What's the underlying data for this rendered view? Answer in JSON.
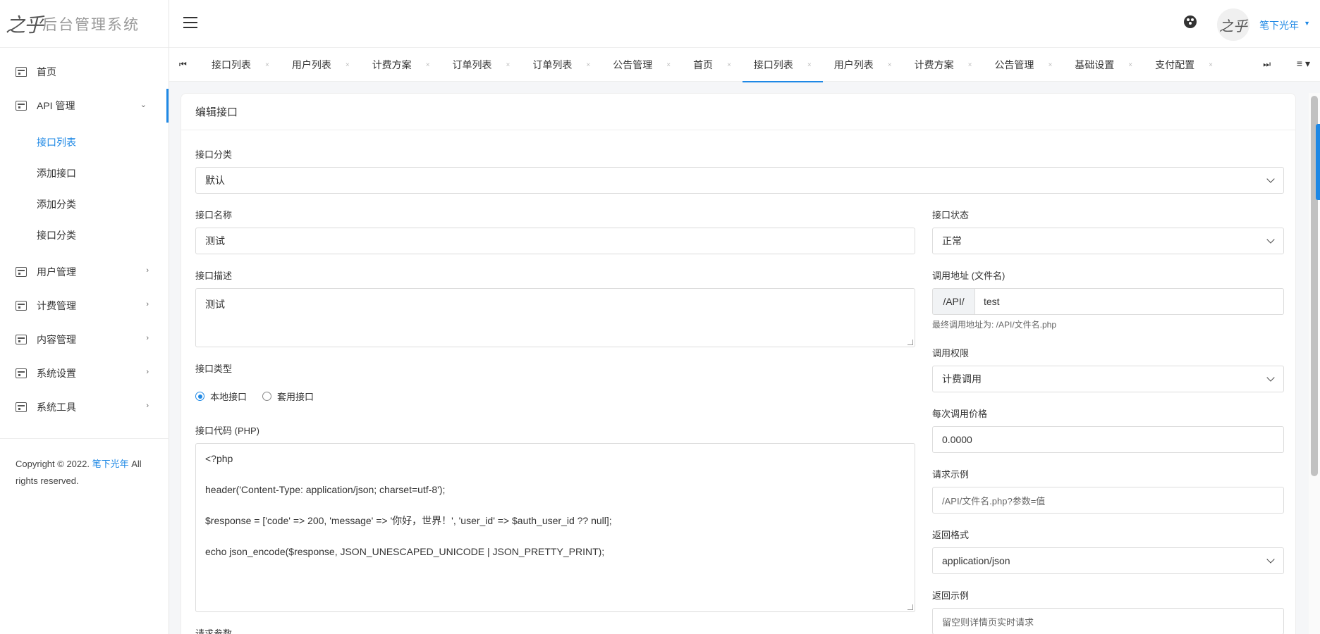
{
  "brand": {
    "logo": "之乎",
    "text": "后台管理系统"
  },
  "sidebar": {
    "items": [
      {
        "label": "首页",
        "icon": "home-icon"
      },
      {
        "label": "API 管理",
        "icon": "calendar-icon"
      },
      {
        "label": "用户管理",
        "icon": "calendar-icon"
      },
      {
        "label": "计费管理",
        "icon": "calendar-icon"
      },
      {
        "label": "内容管理",
        "icon": "calendar-icon"
      },
      {
        "label": "系统设置",
        "icon": "calendar-icon"
      },
      {
        "label": "系统工具",
        "icon": "calendar-icon"
      }
    ],
    "api_sub": [
      "接口列表",
      "添加接口",
      "添加分类",
      "接口分类"
    ],
    "copyright_pre": "Copyright © 2022.",
    "copyright_link": "笔下光年",
    "copyright_post": "All rights reserved."
  },
  "header": {
    "username": "笔下光年",
    "avatar_text": "之乎"
  },
  "tabs": {
    "first_icon": "⏮",
    "last_icon": "⏭",
    "menu_icon": "≡ ▾",
    "items": [
      "接口列表",
      "用户列表",
      "计费方案",
      "订单列表",
      "订单列表",
      "公告管理",
      "首页",
      "接口列表",
      "用户列表",
      "计费方案",
      "公告管理",
      "基础设置",
      "支付配置"
    ],
    "close": "×"
  },
  "form": {
    "title": "编辑接口",
    "category_label": "接口分类",
    "category_value": "默认",
    "name_label": "接口名称",
    "name_value": "测试",
    "desc_label": "接口描述",
    "desc_value": "测试",
    "type_label": "接口类型",
    "type_local": "本地接口",
    "type_wrap": "套用接口",
    "code_label": "接口代码 (PHP)",
    "code_lines": [
      "<?php",
      "header('Content-Type: application/json; charset=utf-8');",
      "$response = ['code' => 200, 'message' => '你好，世界！', 'user_id' => $auth_user_id ?? null];",
      "echo json_encode($response, JSON_UNESCAPED_UNICODE | JSON_PRETTY_PRINT);"
    ],
    "params_label": "请求参数",
    "status_label": "接口状态",
    "status_value": "正常",
    "url_label": "调用地址 (文件名)",
    "url_prefix": "/API/",
    "url_value": "test",
    "url_help": "最终调用地址为: /API/文件名.php",
    "perm_label": "调用权限",
    "perm_value": "计费调用",
    "price_label": "每次调用价格",
    "price_value": "0.0000",
    "example_label": "请求示例",
    "example_placeholder": "/API/文件名.php?参数=值",
    "format_label": "返回格式",
    "format_value": "application/json",
    "return_label": "返回示例",
    "return_placeholder": "留空则详情页实时请求"
  }
}
